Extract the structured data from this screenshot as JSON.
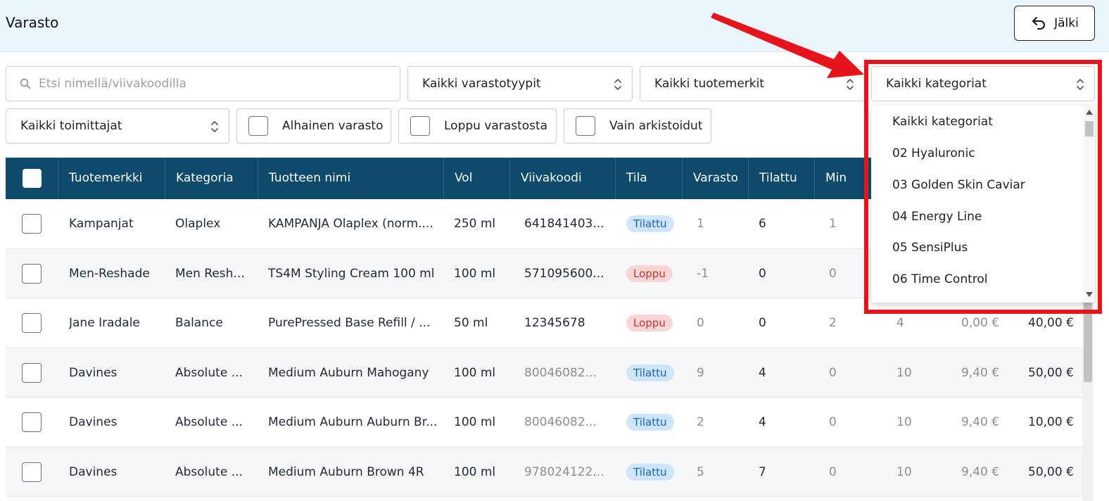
{
  "header": {
    "title": "Varasto",
    "back_label": "Jälki"
  },
  "filters": {
    "search_placeholder": "Etsi nimellä/viivakoodilla",
    "stock_type": "Kaikki varastotyypit",
    "brand": "Kaikki tuotemerkit",
    "category": "Kaikki kategoriat",
    "supplier": "Kaikki toimittajat",
    "low_stock": "Alhainen varasto",
    "out_of_stock": "Loppu varastosta",
    "archived_only": "Vain arkistoidut"
  },
  "table": {
    "columns": [
      "Tuotemerkki",
      "Kategoria",
      "Tuotteen nimi",
      "Vol",
      "Viivakoodi",
      "Tila",
      "Varasto",
      "Tilattu",
      "Min"
    ],
    "rows": [
      {
        "brand": "Kampanjat",
        "category": "Olaplex",
        "name": "KAMPANJA Olaplex (norm....",
        "vol": "250 ml",
        "barcode": "641841403...",
        "status": "Tilattu",
        "stock": "1",
        "ordered": "6",
        "min": "1",
        "c10": "",
        "c11": "",
        "c12": ""
      },
      {
        "brand": "Men-Reshade",
        "category": "Men Resh...",
        "name": "TS4M Styling Cream 100 ml",
        "vol": "100 ml",
        "barcode": "571095600...",
        "status": "Loppu",
        "stock": "-1",
        "ordered": "0",
        "min": "0",
        "c10": "",
        "c11": "",
        "c12": ""
      },
      {
        "brand": "Jane Iradale",
        "category": "Balance",
        "name": "PurePressed Base Refill / ...",
        "vol": "50 ml",
        "barcode": "12345678",
        "status": "Loppu",
        "stock": "0",
        "ordered": "0",
        "min": "2",
        "c10": "4",
        "c11": "0,00 €",
        "c12": "40,00 €"
      },
      {
        "brand": "Davines",
        "category": "Absolute ...",
        "name": "Medium Auburn Mahogany",
        "vol": "100 ml",
        "barcode": "80046082...",
        "status": "Tilattu",
        "stock": "9",
        "ordered": "4",
        "min": "0",
        "c10": "10",
        "c11": "9,40 €",
        "c12": "50,00 €"
      },
      {
        "brand": "Davines",
        "category": "Absolute ...",
        "name": "Medium Auburn Auburn Br...",
        "vol": "100 ml",
        "barcode": "80046082...",
        "status": "Tilattu",
        "stock": "2",
        "ordered": "4",
        "min": "0",
        "c10": "10",
        "c11": "9,40 €",
        "c12": "10,00 €"
      },
      {
        "brand": "Davines",
        "category": "Absolute ...",
        "name": "Medium Auburn Brown 4R",
        "vol": "100 ml",
        "barcode": "978024122...",
        "status": "Tilattu",
        "stock": "5",
        "ordered": "7",
        "min": "0",
        "c10": "10",
        "c11": "9,40 €",
        "c12": "50,00 €"
      }
    ]
  },
  "category_dropdown": {
    "options": [
      "Kaikki kategoriat",
      "02 Hyaluronic",
      "03 Golden Skin Caviar",
      "04 Energy Line",
      "05 SensiPlus",
      "06 Time Control"
    ]
  },
  "colors": {
    "header_bg": "#eaf6fc",
    "table_head": "#0e4a6b",
    "highlight": "#e8141b",
    "badge_ordered": "#cfe5fb",
    "badge_out": "#fbd5d5"
  }
}
